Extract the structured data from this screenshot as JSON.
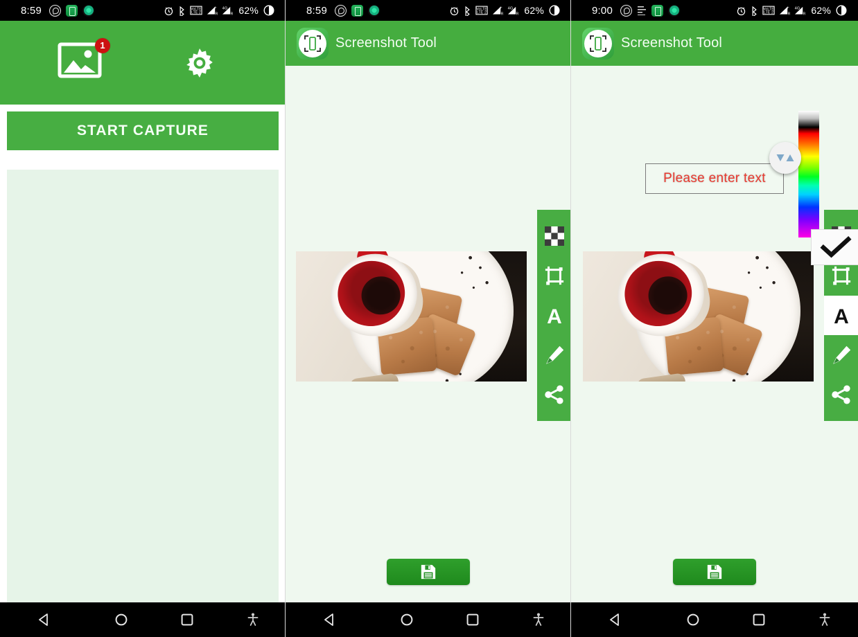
{
  "app": {
    "name": "Screenshot Tool",
    "accent_green": "#45ad3f",
    "panel_bg": "#eff8ef",
    "badge_color": "#cc1111",
    "text_color": "#e8392f"
  },
  "panels": [
    {
      "id": "home",
      "status_bar": {
        "clock": "8:59",
        "battery": "62%",
        "left_icons": [
          "whatsapp-icon",
          "recorder-icon",
          "antivirus-icon"
        ],
        "right_icons": [
          "alarm-icon",
          "bluetooth-icon",
          "volte-icon",
          "signal-1-icon",
          "signal-2-icon",
          "battery-icon"
        ],
        "network": "4G"
      },
      "app_bar": {
        "gallery_icon": "gallery-icon",
        "gallery_badge": "1",
        "settings_icon": "gear-icon"
      },
      "capture_button_label": "START CAPTURE",
      "thumbnail_list": []
    },
    {
      "id": "editor",
      "status_bar": {
        "clock": "8:59",
        "battery": "62%",
        "left_icons": [
          "whatsapp-icon",
          "recorder-icon",
          "antivirus-icon"
        ],
        "right_icons": [
          "alarm-icon",
          "bluetooth-icon",
          "volte-icon",
          "signal-1-icon",
          "signal-2-icon",
          "battery-icon"
        ],
        "network": "4G"
      },
      "app_bar": {
        "title": "Screenshot Tool",
        "logo_icon": "app-logo-icon"
      },
      "tools": [
        {
          "name": "mosaic",
          "icon": "checkerboard-icon",
          "active": false
        },
        {
          "name": "crop",
          "icon": "crop-icon",
          "active": false
        },
        {
          "name": "text",
          "icon": "text-a-icon",
          "active": false
        },
        {
          "name": "draw",
          "icon": "pencil-icon",
          "active": false
        },
        {
          "name": "share",
          "icon": "share-icon",
          "active": false
        }
      ],
      "save_button_icon": "save-floppy-icon",
      "image_caption": "Photo of a red and white coffee cup with toast slices on a plate"
    },
    {
      "id": "editor-text-mode",
      "status_bar": {
        "clock": "9:00",
        "battery": "62%",
        "left_icons": [
          "whatsapp-icon",
          "lines-icon",
          "recorder-icon",
          "antivirus-icon"
        ],
        "right_icons": [
          "alarm-icon",
          "bluetooth-icon",
          "volte-icon",
          "signal-1-icon",
          "signal-2-icon",
          "battery-icon"
        ],
        "network": "4G"
      },
      "app_bar": {
        "title": "Screenshot Tool",
        "logo_icon": "app-logo-icon"
      },
      "tools": [
        {
          "name": "mosaic",
          "icon": "checkerboard-icon",
          "active": false
        },
        {
          "name": "crop",
          "icon": "crop-icon",
          "active": false
        },
        {
          "name": "text",
          "icon": "text-a-icon",
          "active": true
        },
        {
          "name": "draw",
          "icon": "pencil-icon",
          "active": false
        },
        {
          "name": "share",
          "icon": "share-icon",
          "active": false
        }
      ],
      "text_input": {
        "placeholder": "Please enter text",
        "value": ""
      },
      "size_knob_icon": "up-down-triangles-icon",
      "color_picker_icon": "color-gradient-strip",
      "confirm_button_icon": "checkmark-icon",
      "save_button_icon": "save-floppy-icon"
    }
  ],
  "nav_bar": {
    "buttons": [
      {
        "name": "back",
        "icon": "back-triangle-icon"
      },
      {
        "name": "home",
        "icon": "home-circle-icon"
      },
      {
        "name": "recents",
        "icon": "recents-square-icon"
      },
      {
        "name": "accessibility",
        "icon": "accessibility-icon"
      }
    ]
  }
}
